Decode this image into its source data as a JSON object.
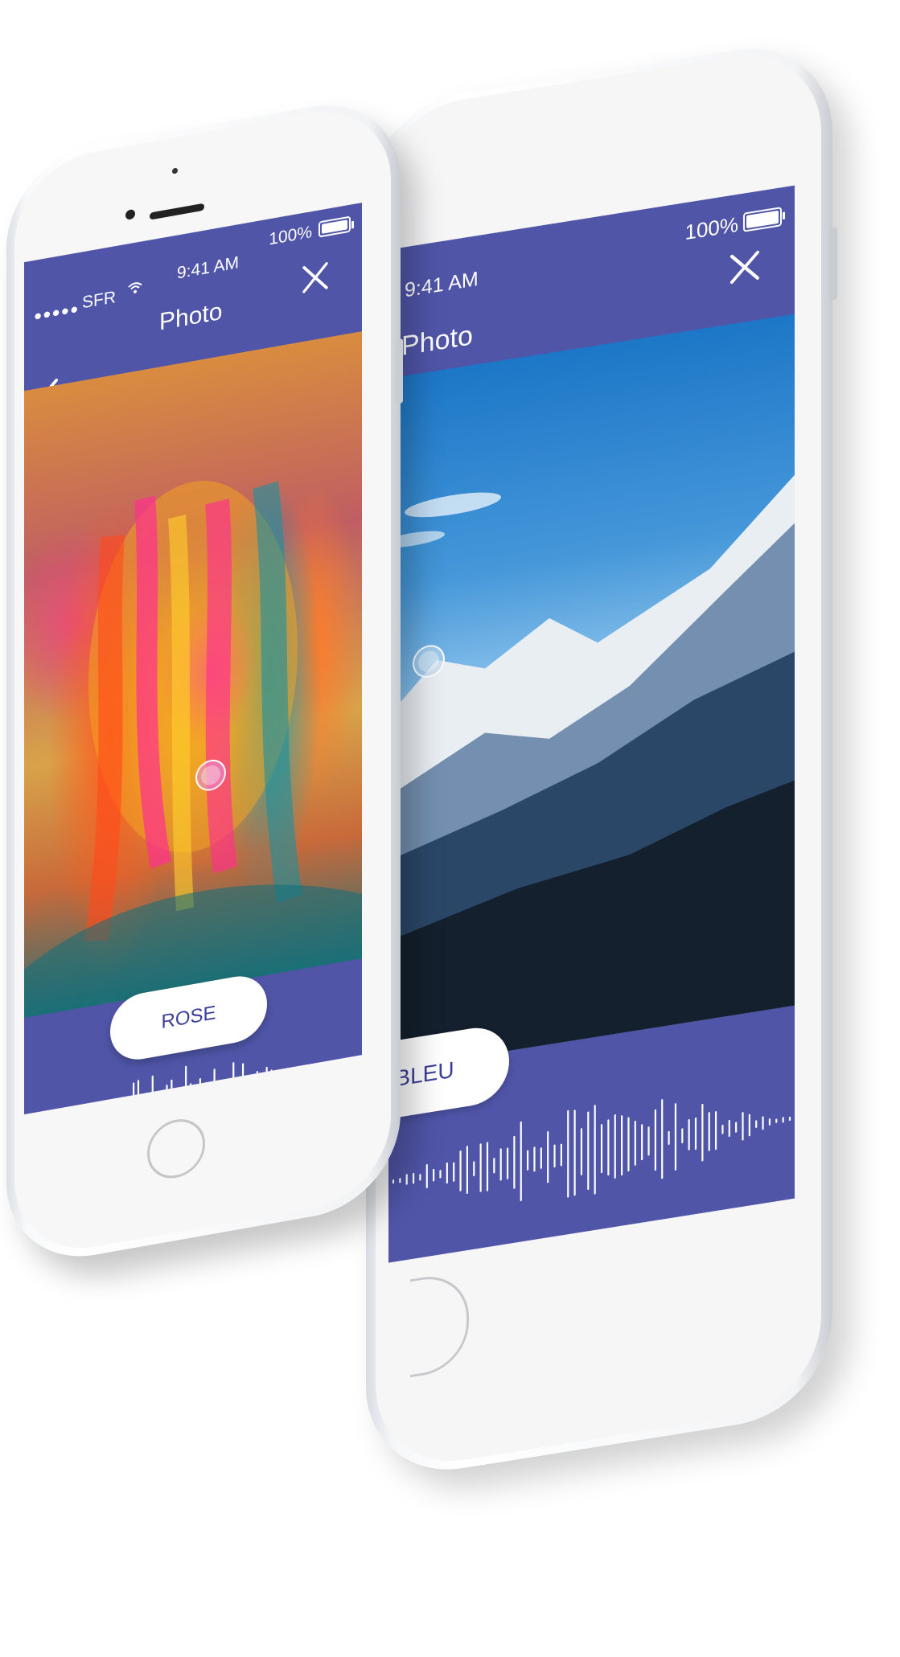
{
  "back_phone": {
    "status": {
      "time": "9:41 AM",
      "battery": "100%"
    },
    "nav": {
      "title": "Photo",
      "close_icon": "close-icon"
    },
    "color_label": "BLEU",
    "photo": "mountain-landscape"
  },
  "front_phone": {
    "status": {
      "signal": "●●●●●",
      "carrier": "SFR",
      "wifi_icon": "wifi-icon",
      "time": "9:41 AM",
      "battery": "100%"
    },
    "nav": {
      "title": "Photo",
      "back_icon": "chevron-left-icon",
      "close_icon": "close-icon"
    },
    "color_label": "ROSE",
    "photo": "paint-covered-face"
  },
  "colors": {
    "screen_bg": "#5055a8",
    "pill_text": "#3c3f9a",
    "wave": "#ffffff"
  }
}
